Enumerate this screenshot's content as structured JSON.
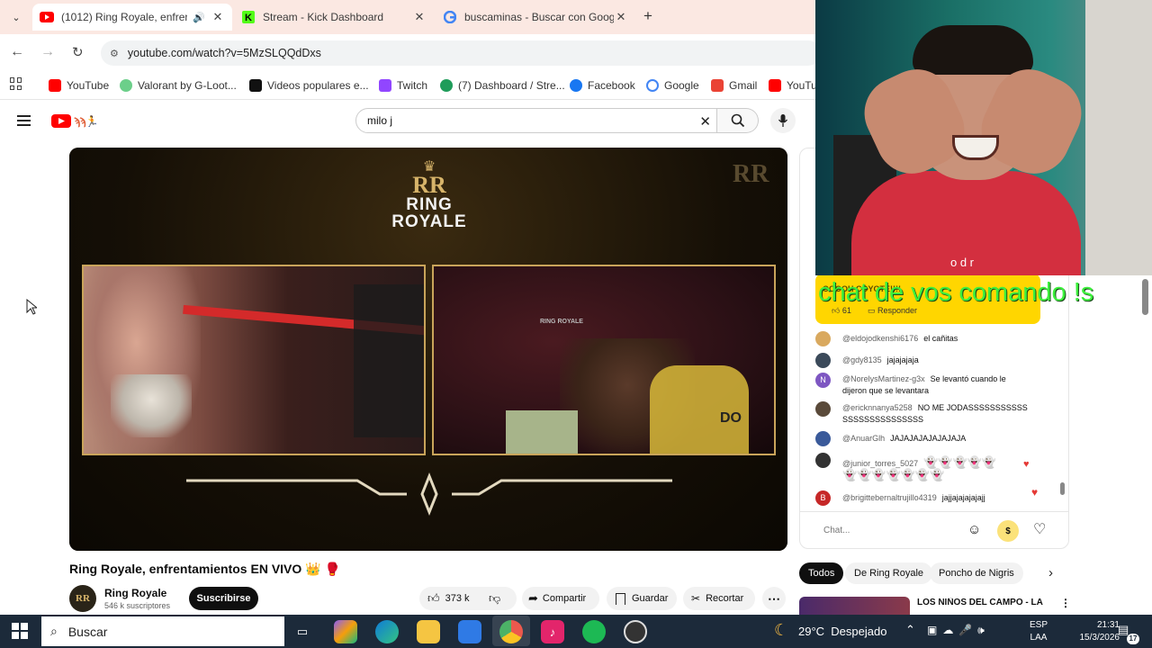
{
  "browser": {
    "tabs": [
      {
        "title": "(1012) Ring Royale, enfrenta",
        "favicon": "youtube-icon",
        "active": true
      },
      {
        "title": "Stream - Kick Dashboard",
        "favicon": "kick-icon",
        "active": false
      },
      {
        "title": "buscaminas - Buscar con Googl",
        "favicon": "google-icon",
        "active": false
      }
    ],
    "new_tab": "+",
    "url": "youtube.com/watch?v=5MzSLQQdDxs",
    "bookmarks": [
      {
        "label": "YouTube",
        "color": "#ff0000"
      },
      {
        "label": "Valorant by G-Loot...",
        "color": "#6ccf8a"
      },
      {
        "label": "Videos populares e...",
        "color": "#111111"
      },
      {
        "label": "Twitch",
        "color": "#9146ff"
      },
      {
        "label": "(7) Dashboard / Stre...",
        "color": "#1f9c5a"
      },
      {
        "label": "Facebook",
        "color": "#1877f2"
      },
      {
        "label": "Google",
        "color": "#4285f4"
      },
      {
        "label": "Gmail",
        "color": "#ea4335"
      },
      {
        "label": "YouTub",
        "color": "#ff0000"
      }
    ]
  },
  "youtube": {
    "search_value": "milo j",
    "video": {
      "logo_line1": "RING",
      "logo_line2": "ROYALE",
      "panel_text": "RING ROYALE",
      "jersey": "DO"
    },
    "title": "Ring Royale, enfrentamientos EN VIVO 👑 🥊",
    "channel": {
      "name": "Ring Royale",
      "subs": "546 k suscriptores",
      "subscribe_label": "Suscribirse"
    },
    "actions": {
      "likes": "373 k",
      "share": "Compartir",
      "save": "Guardar",
      "clip": "Recortar"
    }
  },
  "overlay": {
    "text": "chat de vos comando !s",
    "webcam_letters": "o d r"
  },
  "live_chat": {
    "pinned": {
      "text": "OOOOH COYOTE!!!!",
      "likes": "61",
      "reply_label": "Responder"
    },
    "messages": [
      {
        "user": "@eldojodkenshi6176",
        "text": "el cañitas",
        "color": "#d9a95f"
      },
      {
        "user": "@gdy8135",
        "text": "jajajajaja",
        "color": "#3b4a5a"
      },
      {
        "user": "@NorelysMartinez-g3x",
        "text": "Se levantó cuando le dijeron que se levantara",
        "color": "#7e57c2",
        "initial": "N"
      },
      {
        "user": "@ericknnanya5258",
        "text": "NO ME JODASSSSSSSSSSSSSSSSSSSSSSSSSS",
        "color": "#5a4a3a"
      },
      {
        "user": "@AnuarGlh",
        "text": "JAJAJAJAJAJAJAJA",
        "color": "#3a5a9a"
      },
      {
        "user": "@junior_torres_5027",
        "text": "",
        "color": "#333333"
      },
      {
        "user": "@brigittebernaltrujillo4319",
        "text": "jajjajajajajajj",
        "color": "#c62828",
        "initial": "B"
      }
    ],
    "input_placeholder": "Chat...",
    "chips": [
      "Todos",
      "De Ring Royale",
      "Poncho de Nigris"
    ],
    "recommended_title": "LOS NIÑOS DEL CAMPO - LA"
  },
  "taskbar": {
    "search_label": "Buscar",
    "weather": "29°C  Despejado",
    "lang_top": "ESP",
    "lang_bottom": "LAA",
    "time": "21:31",
    "date": "15/3/2026",
    "notifications": "17"
  }
}
